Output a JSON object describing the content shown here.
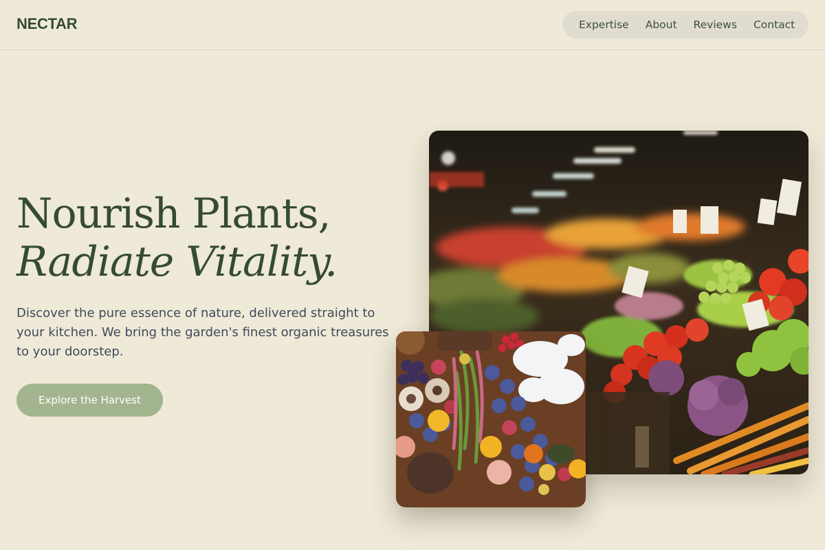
{
  "header": {
    "brand": "NECTAR",
    "nav": [
      "Expertise",
      "About",
      "Reviews",
      "Contact"
    ]
  },
  "hero": {
    "headline_line1": "Nourish Plants,",
    "headline_line2": "Radiate Vitality.",
    "lead": "Discover the pure essence of nature, delivered straight to your kitchen. We bring the garden's finest organic treasures to your doorstep.",
    "cta_label": "Explore the Harvest"
  },
  "images": {
    "market_alt": "Produce market stall with vegetables and fruit",
    "spread_alt": "Assorted fruits and vegetables on a table"
  },
  "colors": {
    "background": "#efe9d8",
    "brand_green": "#354b32",
    "cta_green": "#a3b58e",
    "nav_pill": "#e0dcd0"
  }
}
